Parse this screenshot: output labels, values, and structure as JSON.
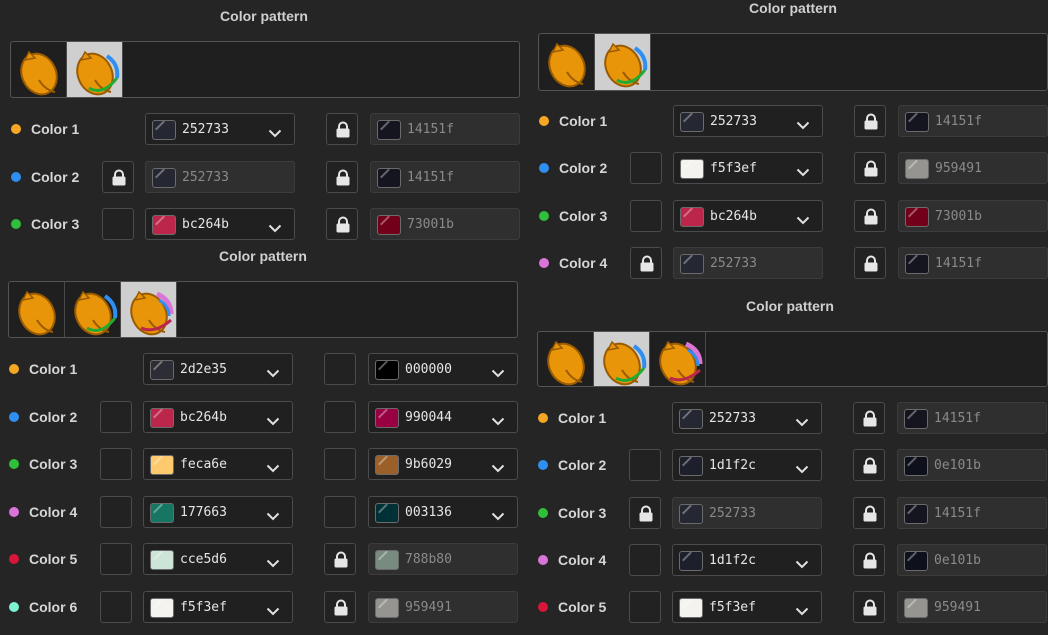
{
  "panels": [
    {
      "id": "a",
      "title": "Color pattern",
      "patterns": 2,
      "selected_pattern": 2,
      "colors": [
        {
          "label": "Color 1",
          "dot": "#f5a623",
          "locked": false,
          "main_hex": "252733",
          "main_color": "#252733",
          "main_enabled": true,
          "shade_locked": true,
          "shade_hex": "14151f",
          "shade_color": "#14151f",
          "shade_enabled": false
        },
        {
          "label": "Color 2",
          "dot": "#2f8ff0",
          "locked": true,
          "main_hex": "252733",
          "main_color": "#252733",
          "main_enabled": false,
          "shade_locked": true,
          "shade_hex": "14151f",
          "shade_color": "#14151f",
          "shade_enabled": false
        },
        {
          "label": "Color 3",
          "dot": "#2fbf3a",
          "locked": false,
          "main_hex": "bc264b",
          "main_color": "#bc264b",
          "main_enabled": true,
          "shade_locked": true,
          "shade_hex": "73001b",
          "shade_color": "#73001b",
          "shade_enabled": false
        }
      ]
    },
    {
      "id": "b",
      "title": "Color pattern",
      "patterns": 3,
      "selected_pattern": 3,
      "colors": [
        {
          "label": "Color 1",
          "dot": "#f5a623",
          "locked": false,
          "main_hex": "2d2e35",
          "main_color": "#2d2e35",
          "main_enabled": true,
          "shade_locked": false,
          "shade_hex": "000000",
          "shade_color": "#000000",
          "shade_enabled": true
        },
        {
          "label": "Color 2",
          "dot": "#2f8ff0",
          "locked": false,
          "main_hex": "bc264b",
          "main_color": "#bc264b",
          "main_enabled": true,
          "shade_locked": false,
          "shade_hex": "990044",
          "shade_color": "#990044",
          "shade_enabled": true
        },
        {
          "label": "Color 3",
          "dot": "#2fbf3a",
          "locked": false,
          "main_hex": "feca6e",
          "main_color": "#feca6e",
          "main_enabled": true,
          "shade_locked": false,
          "shade_hex": "9b6029",
          "shade_color": "#9b6029",
          "shade_enabled": true
        },
        {
          "label": "Color 4",
          "dot": "#d975d6",
          "locked": false,
          "main_hex": "177663",
          "main_color": "#177663",
          "main_enabled": true,
          "shade_locked": false,
          "shade_hex": "003136",
          "shade_color": "#003136",
          "shade_enabled": true
        },
        {
          "label": "Color 5",
          "dot": "#d8163a",
          "locked": false,
          "main_hex": "cce5d6",
          "main_color": "#cce5d6",
          "main_enabled": true,
          "shade_locked": true,
          "shade_hex": "788b80",
          "shade_color": "#788b80",
          "shade_enabled": false
        },
        {
          "label": "Color 6",
          "dot": "#7ef2d3",
          "locked": false,
          "main_hex": "f5f3ef",
          "main_color": "#f5f3ef",
          "main_enabled": true,
          "shade_locked": true,
          "shade_hex": "959491",
          "shade_color": "#959491",
          "shade_enabled": false
        }
      ]
    },
    {
      "id": "c",
      "title": "Color pattern",
      "patterns": 2,
      "selected_pattern": 2,
      "colors": [
        {
          "label": "Color 1",
          "dot": "#f5a623",
          "locked": false,
          "main_hex": "252733",
          "main_color": "#252733",
          "main_enabled": true,
          "shade_locked": true,
          "shade_hex": "14151f",
          "shade_color": "#14151f",
          "shade_enabled": false
        },
        {
          "label": "Color 2",
          "dot": "#2f8ff0",
          "locked": false,
          "main_hex": "f5f3ef",
          "main_color": "#f5f3ef",
          "main_enabled": true,
          "shade_locked": true,
          "shade_hex": "959491",
          "shade_color": "#959491",
          "shade_enabled": false
        },
        {
          "label": "Color 3",
          "dot": "#2fbf3a",
          "locked": false,
          "main_hex": "bc264b",
          "main_color": "#bc264b",
          "main_enabled": true,
          "shade_locked": true,
          "shade_hex": "73001b",
          "shade_color": "#73001b",
          "shade_enabled": false
        },
        {
          "label": "Color 4",
          "dot": "#d975d6",
          "locked": true,
          "main_hex": "252733",
          "main_color": "#252733",
          "main_enabled": false,
          "shade_locked": true,
          "shade_hex": "14151f",
          "shade_color": "#14151f",
          "shade_enabled": false
        }
      ]
    },
    {
      "id": "d",
      "title": "Color pattern",
      "patterns": 3,
      "selected_pattern": 2,
      "colors": [
        {
          "label": "Color 1",
          "dot": "#f5a623",
          "locked": false,
          "main_hex": "252733",
          "main_color": "#252733",
          "main_enabled": true,
          "shade_locked": true,
          "shade_hex": "14151f",
          "shade_color": "#14151f",
          "shade_enabled": false
        },
        {
          "label": "Color 2",
          "dot": "#2f8ff0",
          "locked": false,
          "main_hex": "1d1f2c",
          "main_color": "#1d1f2c",
          "main_enabled": true,
          "shade_locked": true,
          "shade_hex": "0e101b",
          "shade_color": "#0e101b",
          "shade_enabled": false
        },
        {
          "label": "Color 3",
          "dot": "#2fbf3a",
          "locked": true,
          "main_hex": "252733",
          "main_color": "#252733",
          "main_enabled": false,
          "shade_locked": true,
          "shade_hex": "14151f",
          "shade_color": "#14151f",
          "shade_enabled": false
        },
        {
          "label": "Color 4",
          "dot": "#d975d6",
          "locked": false,
          "main_hex": "1d1f2c",
          "main_color": "#1d1f2c",
          "main_enabled": true,
          "shade_locked": true,
          "shade_hex": "0e101b",
          "shade_color": "#0e101b",
          "shade_enabled": false
        },
        {
          "label": "Color 5",
          "dot": "#d8163a",
          "locked": false,
          "main_hex": "f5f3ef",
          "main_color": "#f5f3ef",
          "main_enabled": true,
          "shade_locked": true,
          "shade_hex": "959491",
          "shade_color": "#959491",
          "shade_enabled": false
        }
      ]
    }
  ]
}
